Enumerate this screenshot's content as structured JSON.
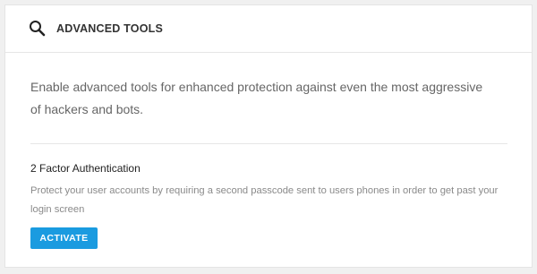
{
  "header": {
    "title": "ADVANCED TOOLS",
    "icon": "search-icon"
  },
  "intro": {
    "text": "Enable advanced tools for enhanced protection against even the most aggressive of hackers and bots."
  },
  "two_factor": {
    "title": "2 Factor Authentication",
    "description": "Protect your user accounts by requiring a second passcode sent to users phones in order to get past your login screen",
    "button_label": "ACTIVATE"
  },
  "colors": {
    "accent": "#1a9be0",
    "background": "#f0f0f0",
    "card": "#ffffff"
  }
}
